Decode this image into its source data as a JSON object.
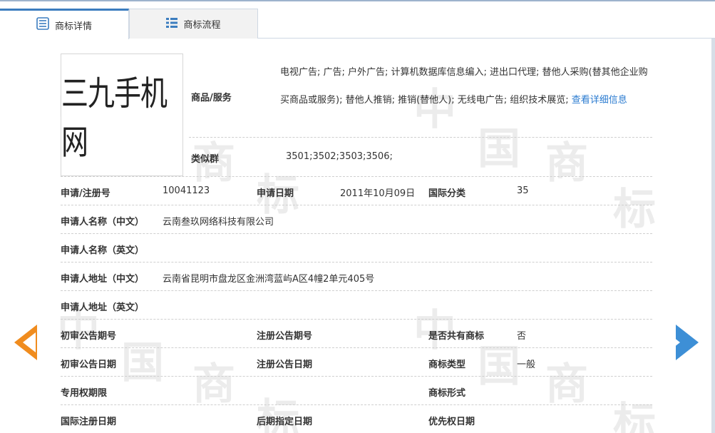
{
  "tabs": [
    {
      "label": "商标详情",
      "icon": "document-list-icon"
    },
    {
      "label": "商标流程",
      "icon": "grid-list-icon"
    }
  ],
  "trademark_image_text": "三九手机网",
  "goods_services": {
    "label": "商品/服务",
    "text": "电视广告; 广告; 户外广告; 计算机数据库信息编入; 进出口代理; 替他人采购(替其他企业购买商品或服务); 替他人推销; 推销(替他人); 无线电广告; 组织技术展览;",
    "link": "查看详细信息"
  },
  "similar_group": {
    "label": "类似群",
    "value": "3501;3502;3503;3506;"
  },
  "rows": {
    "reg_no_label": "申请/注册号",
    "reg_no": "10041123",
    "app_date_label": "申请日期",
    "app_date": "2011年10月09日",
    "intl_class_label": "国际分类",
    "intl_class": "35",
    "applicant_cn_label": "申请人名称（中文）",
    "applicant_cn": "云南叁玖网络科技有限公司",
    "applicant_en_label": "申请人名称（英文）",
    "applicant_en": "",
    "address_cn_label": "申请人地址（中文）",
    "address_cn": "云南省昆明市盘龙区金洲湾蓝屿A区4幢2单元405号",
    "address_en_label": "申请人地址（英文）",
    "address_en": "",
    "prelim_no_label": "初审公告期号",
    "prelim_no": "",
    "reg_pub_no_label": "注册公告期号",
    "reg_pub_no": "",
    "shared_label": "是否共有商标",
    "shared": "否",
    "prelim_date_label": "初审公告日期",
    "prelim_date": "",
    "reg_pub_date_label": "注册公告日期",
    "reg_pub_date": "",
    "type_label": "商标类型",
    "type": "一般",
    "exclusive_label": "专用权期限",
    "exclusive": "",
    "form_label": "商标形式",
    "form": "",
    "intl_reg_date_label": "国际注册日期",
    "intl_reg_date": "",
    "later_date_label": "后期指定日期",
    "later_date": "",
    "priority_date_label": "优先权日期",
    "priority_date": ""
  },
  "watermark_chars": [
    "中",
    "国",
    "商",
    "标"
  ],
  "nav": {
    "prev": "previous-arrow-icon",
    "next": "next-arrow-icon"
  },
  "colors": {
    "accent": "#3c7dbf",
    "link": "#2a7bd0",
    "prev_arrow": "#f08c1e",
    "next_arrow": "#3d8fd6"
  }
}
